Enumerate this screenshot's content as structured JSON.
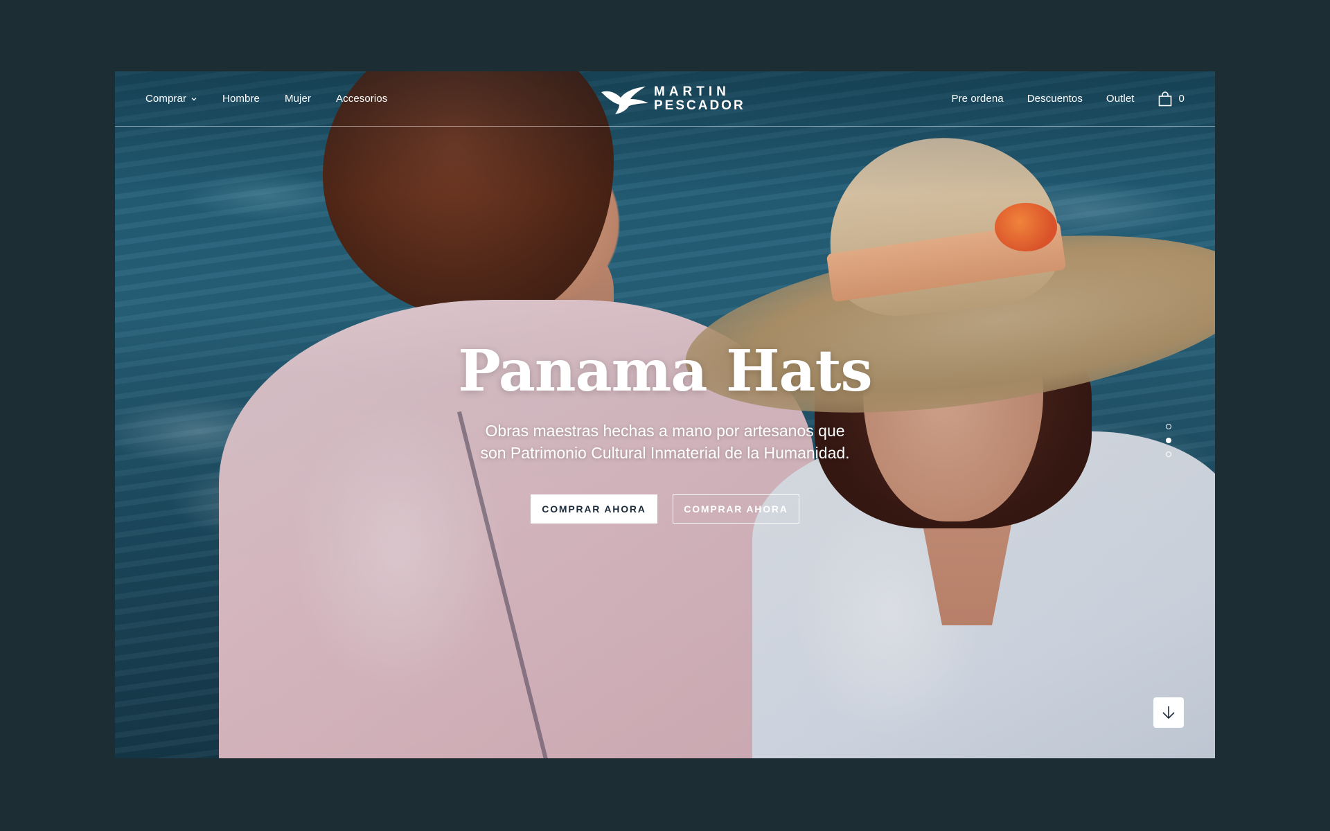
{
  "nav": {
    "left_items": [
      {
        "label": "Comprar",
        "has_dropdown": true
      },
      {
        "label": "Hombre"
      },
      {
        "label": "Mujer"
      },
      {
        "label": "Accesorios"
      }
    ],
    "right_items": [
      {
        "label": "Pre ordena"
      },
      {
        "label": "Descuentos"
      },
      {
        "label": "Outlet"
      }
    ],
    "cart_count": "0"
  },
  "logo": {
    "line1": "MARTIN",
    "line2": "PESCADOR",
    "icon": "bird-icon"
  },
  "hero": {
    "title": "Panama Hats",
    "subtitle_line1": "Obras maestras hechas a mano por artesanos que",
    "subtitle_line2": "son Patrimonio Cultural Inmaterial de la Humanidad.",
    "primary_button": "COMPRAR AHORA",
    "secondary_button": "COMPRAR AHORA"
  },
  "carousel": {
    "slide_count": 3,
    "active_index": 1
  },
  "icons": {
    "dropdown": "chevron-down-icon",
    "cart": "shopping-bag-icon",
    "scroll": "arrow-down-icon"
  },
  "colors": {
    "page_background": "#1c2d34",
    "nav_text": "#ffffff",
    "primary_button_bg": "#ffffff",
    "primary_button_text": "#1b2b3a"
  }
}
